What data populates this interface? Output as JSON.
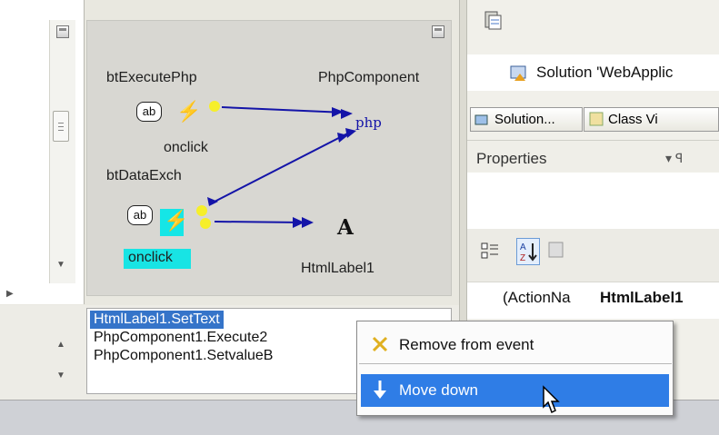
{
  "designer": {
    "button1_caption": "btExecutePhp",
    "button1_icon": "ab",
    "button1_event": "onclick",
    "button2_caption": "btDataExch",
    "button2_icon": "ab",
    "button2_event": "onclick",
    "php_component_caption": "PhpComponent",
    "php_icon_label": "php",
    "label_icon_glyph": "A",
    "label_caption": "HtmlLabel1",
    "highlight_color": "#15e6e6",
    "link_color": "#1414a8",
    "port_color": "#f6ef2a"
  },
  "event_list": {
    "items": [
      {
        "label": "HtmlLabel1.SetText",
        "selected": true
      },
      {
        "label": "PhpComponent1.Execute2",
        "selected": false
      },
      {
        "label": "PhpComponent1.SetvalueB",
        "selected": false
      }
    ]
  },
  "context_menu": {
    "remove_label": "Remove from event",
    "move_down_label": "Move down",
    "highlight_color": "#2f7de6"
  },
  "solution": {
    "title": "Solution 'WebApplic",
    "tab_solution": "Solution...",
    "tab_class": "Class Vi"
  },
  "properties": {
    "title": "Properties",
    "pin_glyph": "▾ ꟼ",
    "row_name": "(ActionNa",
    "row_value": "HtmlLabel1"
  }
}
